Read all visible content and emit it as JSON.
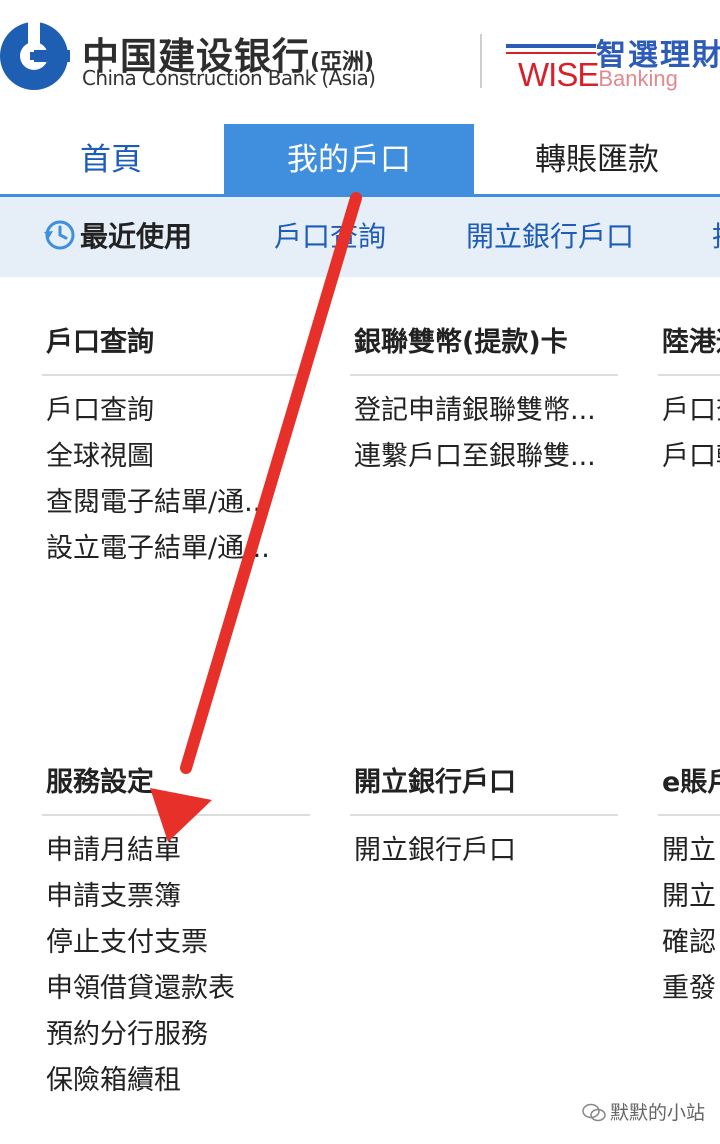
{
  "header": {
    "brand_cn": "中国建设银行",
    "brand_cn_asia": "(亞洲)",
    "brand_en": "China Construction Bank (Asia)",
    "wise_cn": "智選理財",
    "wise_en_word": "WISE",
    "wise_en_banking": "Banking"
  },
  "tabs": [
    {
      "label": "首頁"
    },
    {
      "label": "我的戶口"
    },
    {
      "label": "轉賬匯款"
    }
  ],
  "subnav": {
    "recent_label": "最近使用",
    "items": [
      {
        "label": "戶口查詢"
      },
      {
        "label": "開立銀行戶口"
      },
      {
        "label": "托"
      }
    ]
  },
  "sections": {
    "account_inquiry": {
      "title": "戶口查詢",
      "links": [
        "戶口查詢",
        "全球視圖",
        "查閱電子結單/通...",
        "設立電子結單/通..."
      ]
    },
    "unionpay": {
      "title": "銀聯雙幣(提款)卡",
      "links": [
        "登記申請銀聯雙幣...",
        "連繫戶口至銀聯雙..."
      ]
    },
    "mainland_hk": {
      "title": "陸港通",
      "links": [
        "戶口查詢",
        "戶口轉賬"
      ]
    },
    "service_settings": {
      "title": "服務設定",
      "links": [
        "申請月結單",
        "申請支票簿",
        "停止支付支票",
        "申領借貸還款表",
        "預約分行服務",
        "保險箱續租"
      ]
    },
    "open_account": {
      "title": "開立銀行戶口",
      "links": [
        "開立銀行戶口"
      ]
    },
    "e_statement": {
      "title": "e賬戶",
      "links": [
        "開立",
        "開立",
        "確認",
        "重發"
      ]
    }
  },
  "watermark": "默默的小站",
  "colors": {
    "accent": "#3f8fde",
    "link_blue": "#1d5cb8",
    "subnav_bg": "#e6eef7",
    "annotation_arrow": "#e8302a"
  }
}
